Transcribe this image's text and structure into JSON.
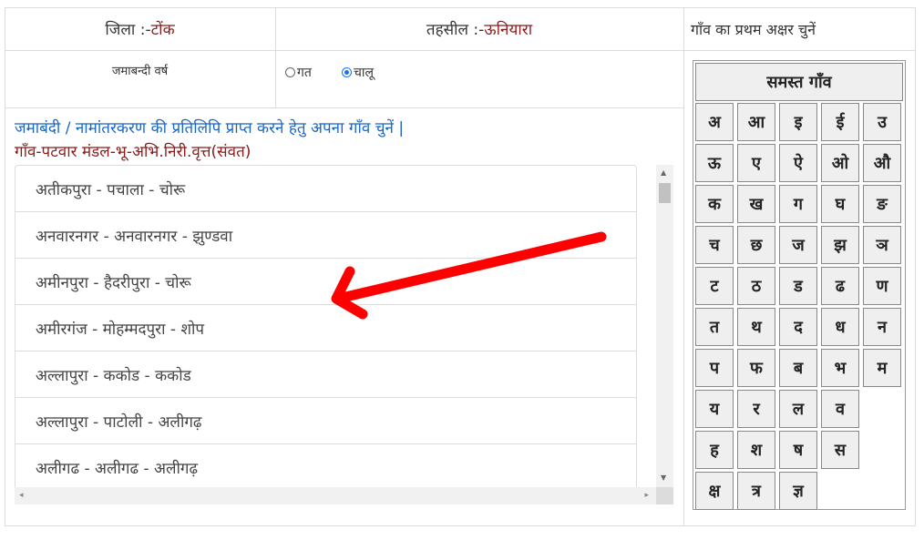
{
  "header": {
    "district_label": "जिला :-",
    "district_value": "टोंक",
    "tehsil_label": "तहसील :- ",
    "tehsil_value": "ऊनियारा",
    "alpha_prompt": "गाँव का प्रथम अक्षर चुनें"
  },
  "jamabandi": {
    "label": "जमाबन्दी वर्ष",
    "options": [
      {
        "label": "गत",
        "selected": false
      },
      {
        "label": "चालू",
        "selected": true
      }
    ]
  },
  "instruction": "जमाबंदी / नामांतरकरण की प्रतिलिपि प्राप्त करने हेतु अपना गाँव चुनें |",
  "list_heading": "गाँव-पटवार मंडल-भू-अभि.निरी.वृत्त(संवत)",
  "villages": [
    "अतीकपुरा - पचाला - चोरू",
    "अनवारनगर - अनवारनगर - झुण्डवा",
    "अमीनपुरा - हैदरीपुरा - चोरू",
    "अमीरगंज - मोहम्मदपुरा - शोप",
    "अल्लापुरा - ककोड - ककोड",
    "अल्लापुरा - पाटोली - अलीगढ़",
    "अलीगढ - अलीगढ - अलीगढ़"
  ],
  "alphabet": {
    "all_label": "समस्त गाँव",
    "letters": [
      "अ",
      "आ",
      "इ",
      "ई",
      "उ",
      "ऊ",
      "ए",
      "ऐ",
      "ओ",
      "औ",
      "क",
      "ख",
      "ग",
      "घ",
      "ङ",
      "च",
      "छ",
      "ज",
      "झ",
      "ञ",
      "ट",
      "ठ",
      "ड",
      "ढ",
      "ण",
      "त",
      "थ",
      "द",
      "ध",
      "न",
      "प",
      "फ",
      "ब",
      "भ",
      "म",
      "य",
      "र",
      "ल",
      "व",
      "ह",
      "श",
      "ष",
      "स",
      "क्ष",
      "त्र",
      "ज्ञ"
    ]
  },
  "annotation_color": "#ff0000"
}
